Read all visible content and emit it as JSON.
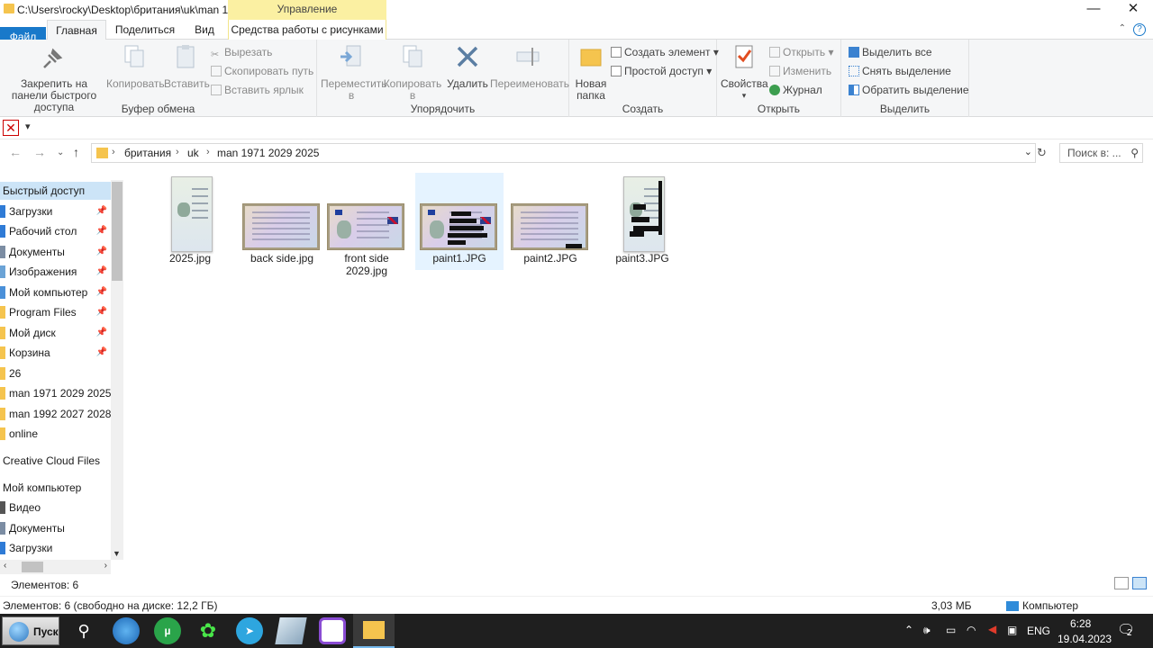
{
  "window": {
    "title": "C:\\Users\\rocky\\Desktop\\британия\\uk\\man 1...",
    "context_header": "Управление",
    "minimize": "—",
    "maximize": "❐",
    "close": "✕"
  },
  "tabs": [
    "Файл",
    "Главная",
    "Поделиться",
    "Вид",
    "Средства работы с рисунками"
  ],
  "ribbon": {
    "clipboard": {
      "label": "Буфер обмена",
      "pin": "Закрепить на панели быстрого доступа",
      "copy": "Копировать",
      "paste": "Вставить",
      "cut": "Вырезать",
      "copy_path": "Скопировать путь",
      "paste_shortcut": "Вставить ярлык"
    },
    "organize": {
      "label": "Упорядочить",
      "move": "Переместить в",
      "copy_to": "Копировать в",
      "delete": "Удалить",
      "rename": "Переименовать"
    },
    "create": {
      "label": "Создать",
      "new_folder": "Новая папка",
      "new_item": "Создать элемент",
      "easy_access": "Простой доступ"
    },
    "open": {
      "label": "Открыть",
      "properties": "Свойства",
      "open": "Открыть",
      "edit": "Изменить",
      "history": "Журнал"
    },
    "select": {
      "label": "Выделить",
      "select_all": "Выделить все",
      "select_none": "Снять выделение",
      "invert": "Обратить выделение"
    }
  },
  "address": {
    "crumbs": [
      "британия",
      "uk",
      "man 1971 2029 2025"
    ],
    "search_placeholder": "Поиск в: ..."
  },
  "nav": {
    "quick_access": "Быстрый доступ",
    "items": [
      {
        "label": "Загрузки",
        "pinned": true,
        "color": "#2f7bd6"
      },
      {
        "label": "Рабочий стол",
        "pinned": true,
        "color": "#2f7bd6"
      },
      {
        "label": "Документы",
        "pinned": true,
        "color": "#7c8da3"
      },
      {
        "label": "Изображения",
        "pinned": true,
        "color": "#6ba3d6"
      },
      {
        "label": "Мой компьютер",
        "pinned": true,
        "color": "#4a90d9"
      },
      {
        "label": "Program Files",
        "pinned": true,
        "color": "#f5c44e"
      },
      {
        "label": "Мой диск",
        "pinned": true,
        "color": "#f5c44e"
      },
      {
        "label": "Корзина",
        "pinned": true,
        "color": "#f5c44e"
      },
      {
        "label": "26",
        "pinned": false,
        "color": "#f5c44e"
      },
      {
        "label": "man 1971 2029 2025",
        "pinned": false,
        "color": "#f5c44e"
      },
      {
        "label": "man 1992 2027 2028",
        "pinned": false,
        "color": "#f5c44e"
      },
      {
        "label": "online",
        "pinned": false,
        "color": "#f5c44e"
      }
    ],
    "creative_cloud": "Creative Cloud Files",
    "my_computer": "Мой компьютер",
    "computer_items": [
      {
        "label": "Видео",
        "color": "#555"
      },
      {
        "label": "Документы",
        "color": "#7c8da3"
      },
      {
        "label": "Загрузки",
        "color": "#2f7bd6"
      }
    ]
  },
  "files": [
    {
      "name": "2025.jpg",
      "kind": "portrait",
      "selected": false
    },
    {
      "name": "back side.jpg",
      "kind": "licence-back",
      "selected": false
    },
    {
      "name": "front side 2029.jpg",
      "kind": "licence-front",
      "selected": false
    },
    {
      "name": "paint1.JPG",
      "kind": "licence-redacted",
      "selected": true
    },
    {
      "name": "paint2.JPG",
      "kind": "licence-back-redacted",
      "selected": false
    },
    {
      "name": "paint3.JPG",
      "kind": "portrait-redacted",
      "selected": false
    }
  ],
  "status": {
    "items": "Элементов: 6 (свободно на диске: 12,2 ГБ)",
    "count": "Элементов: 6",
    "size": "3,03 МБ",
    "location": "Компьютер"
  },
  "taskbar": {
    "start": "Пуск",
    "lang": "ENG",
    "time": "6:28",
    "date": "19.04.2023",
    "notifications": "2"
  }
}
